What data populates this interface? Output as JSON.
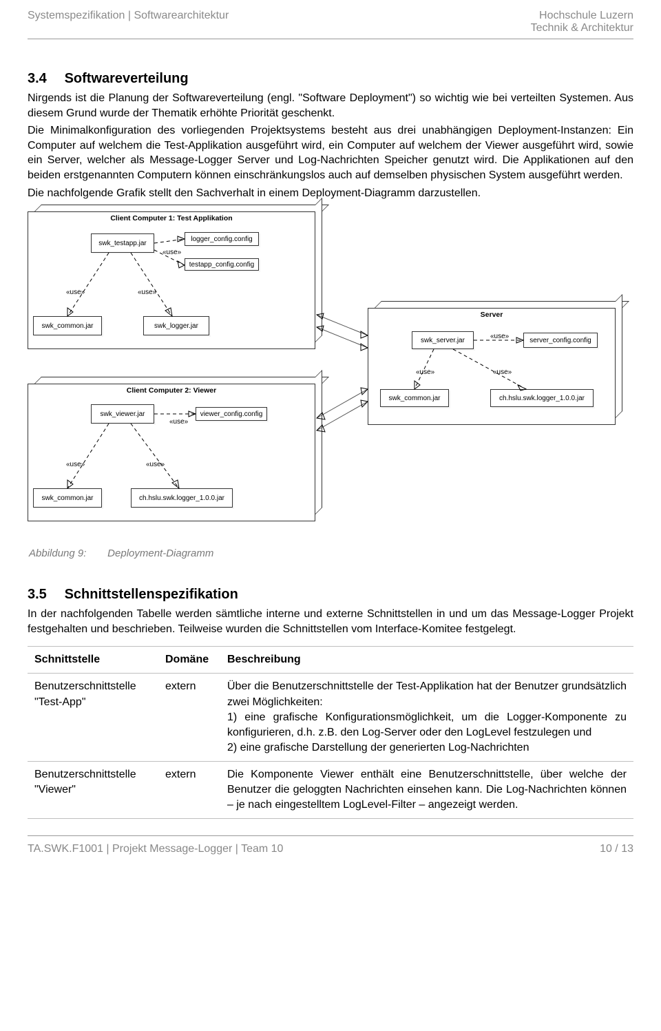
{
  "header": {
    "left": "Systemspezifikation | Softwarearchitektur",
    "right1": "Hochschule Luzern",
    "right2": "Technik & Architektur"
  },
  "section34": {
    "num": "3.4",
    "title": "Softwareverteilung",
    "p1": "Nirgends ist die Planung der Softwareverteilung (engl. \"Software Deployment\") so wichtig wie bei verteilten Systemen. Aus diesem Grund wurde der Thematik erhöhte Priorität geschenkt.",
    "p2": "Die Minimalkonfiguration des vorliegenden Projektsystems besteht aus drei unabhängigen Deployment-Instanzen: Ein Computer auf welchem die Test-Applikation ausgeführt wird, ein Computer auf welchem der Viewer ausgeführt wird, sowie ein Server, welcher als Message-Logger Server und Log-Nachrichten Speicher genutzt wird. Die Applikationen auf den beiden erstgenannten Computern können einschränkungslos auch auf demselben physischen System ausgeführt werden.",
    "p3": "Die nachfolgende Grafik stellt den Sachverhalt in einem Deployment-Diagramm darzustellen."
  },
  "diagram": {
    "node1": "Client Computer 1: Test Applikation",
    "node2": "Client Computer 2: Viewer",
    "node3": "Server",
    "use": "«use»",
    "a_swk_testapp": "swk_testapp.jar",
    "a_logger_config": "logger_config.config",
    "a_testapp_config": "testapp_config.config",
    "a_swk_common": "swk_common.jar",
    "a_swk_logger": "swk_logger.jar",
    "a_swk_viewer": "swk_viewer.jar",
    "a_viewer_config": "viewer_config.config",
    "a_ch_hslu_logger": "ch.hslu.swk.logger_1.0.0.jar",
    "a_swk_server": "swk_server.jar",
    "a_server_config": "server_config.config"
  },
  "figcap": {
    "lead": "Abbildung 9:",
    "text": "Deployment-Diagramm"
  },
  "section35": {
    "num": "3.5",
    "title": "Schnittstellenspezifikation",
    "p1": "In der nachfolgenden Tabelle werden sämtliche interne und externe Schnittstellen in und um das Message-Logger Projekt festgehalten und beschrieben. Teilweise wurden die Schnittstellen vom Interface-Komitee festgelegt."
  },
  "table": {
    "h1": "Schnittstelle",
    "h2": "Domäne",
    "h3": "Beschreibung",
    "rows": [
      {
        "iface": "Benutzerschnittstelle \"Test-App\"",
        "domain": "extern",
        "desc": "Über die Benutzerschnittstelle der Test-Applikation hat der Benutzer grundsätzlich zwei Möglichkeiten:\n1) eine grafische Konfigurationsmöglichkeit, um die Logger-Komponente zu konfigurieren, d.h. z.B. den Log-Server oder den LogLevel festzulegen und\n2) eine grafische Darstellung der generierten Log-Nachrichten"
      },
      {
        "iface": "Benutzerschnittstelle \"Viewer\"",
        "domain": "extern",
        "desc": "Die Komponente Viewer enthält eine Benutzerschnittstelle, über welche der Benutzer die geloggten Nachrichten einsehen kann. Die Log-Nachrichten können – je nach eingestelltem LogLevel-Filter – angezeigt werden."
      }
    ]
  },
  "footer": {
    "left": "TA.SWK.F1001 | Projekt Message-Logger | Team 10",
    "right": "10 / 13"
  }
}
